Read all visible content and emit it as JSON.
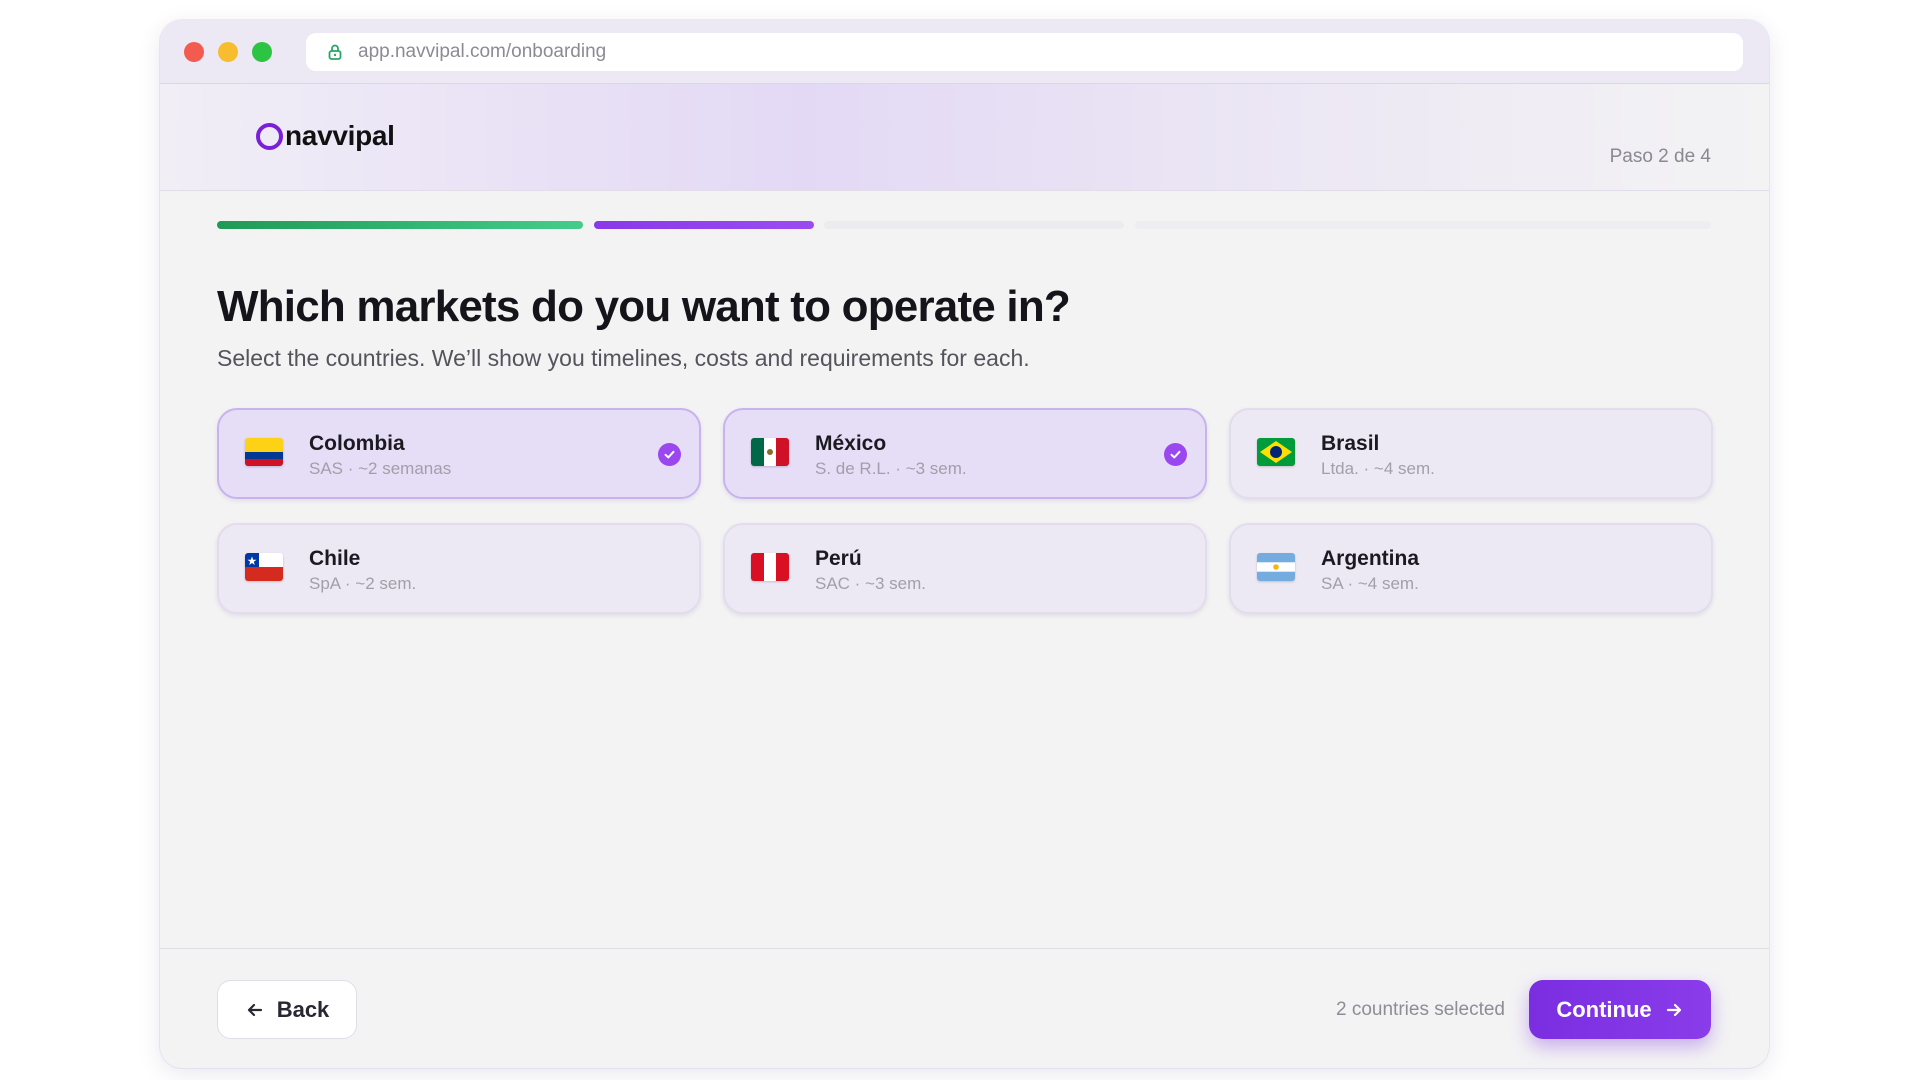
{
  "browser": {
    "url": "app.navvipal.com/onboarding"
  },
  "header": {
    "logo_text": "navvipal",
    "step_label": "Paso 2 de 4"
  },
  "progress": {
    "current_step": 2,
    "total_steps": 4,
    "colors": {
      "completed": "#1f9a55",
      "active": "#8a38e8",
      "pending": "#ececef"
    }
  },
  "main": {
    "title": "Which markets do you want to operate in?",
    "subtitle": "Select the countries. We’ll show you timelines, costs and requirements for each."
  },
  "countries": [
    {
      "name": "Colombia",
      "meta": "SAS · ~2 semanas",
      "selected": true,
      "flag": "colombia-flag"
    },
    {
      "name": "México",
      "meta": "S. de R.L. · ~3 sem.",
      "selected": true,
      "flag": "mexico-flag"
    },
    {
      "name": "Brasil",
      "meta": "Ltda. · ~4 sem.",
      "selected": false,
      "flag": "brazil-flag"
    },
    {
      "name": "Chile",
      "meta": "SpA · ~2 sem.",
      "selected": false,
      "flag": "chile-flag"
    },
    {
      "name": "Perú",
      "meta": "SAC · ~3 sem.",
      "selected": false,
      "flag": "peru-flag"
    },
    {
      "name": "Argentina",
      "meta": "SA · ~4 sem.",
      "selected": false,
      "flag": "argentina-flag"
    }
  ],
  "footer": {
    "back_label": "Back",
    "selected_count": "2 countries selected",
    "continue_label": "Continue"
  },
  "colors": {
    "accent": "#7a2ee0",
    "check": "#9a47ef",
    "selected_card": "#e6ddf7"
  }
}
